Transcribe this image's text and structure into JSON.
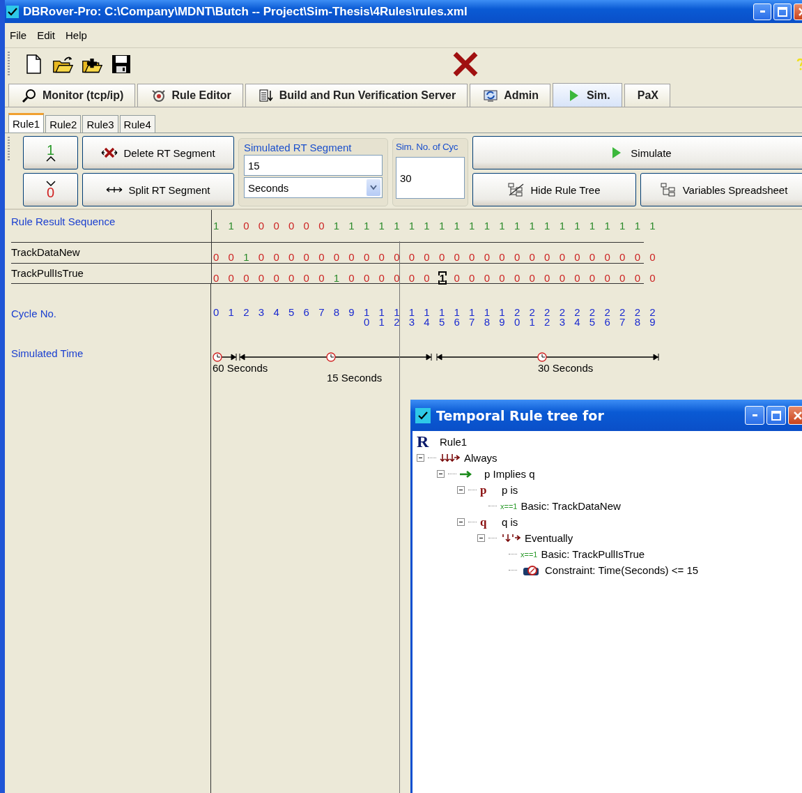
{
  "window": {
    "title": "DBRover-Pro: C:\\Company\\MDNT\\Butch -- Project\\Sim-Thesis\\4Rules\\rules.xml"
  },
  "menu": [
    "File",
    "Edit",
    "Help"
  ],
  "main_tabs": [
    {
      "label": "Monitor (tcp/ip)",
      "kind": "monitor",
      "selected": false
    },
    {
      "label": "Rule Editor",
      "kind": "editor",
      "selected": false
    },
    {
      "label": "Build and Run Verification Server",
      "kind": "build",
      "selected": false
    },
    {
      "label": "Admin",
      "kind": "admin",
      "selected": false
    },
    {
      "label": "Sim.",
      "kind": "sim",
      "selected": true
    },
    {
      "label": "PaX",
      "kind": "none",
      "selected": false
    }
  ],
  "rule_tabs": [
    {
      "label": "Rule1",
      "selected": true
    },
    {
      "label": "Rule2",
      "selected": false
    },
    {
      "label": "Rule3",
      "selected": false
    },
    {
      "label": "Rule4",
      "selected": false
    }
  ],
  "controls": {
    "increment_button": "1",
    "delete_button": "Delete RT Segment",
    "decrement_button": "0",
    "split_button": "Split RT Segment",
    "segment_group": {
      "legend": "Simulated RT Segment",
      "value": "15",
      "unit": "Seconds"
    },
    "cycles_group": {
      "legend": "Sim. No. of Cyc",
      "value": "30"
    },
    "simulate_button": "Simulate",
    "hide_tree_button": "Hide Rule Tree",
    "variables_button": "Variables Spreadsheet"
  },
  "sequence": {
    "rows": [
      {
        "label": "Rule Result Sequence",
        "kind": "result",
        "values": [
          "1",
          "1",
          "0",
          "0",
          "0",
          "0",
          "0",
          "0",
          "1",
          "1",
          "1",
          "1",
          "1",
          "1",
          "1",
          "1",
          "1",
          "1",
          "1",
          "1",
          "1",
          "1",
          "1",
          "1",
          "1",
          "1",
          "1",
          "1",
          "1",
          "1"
        ]
      },
      {
        "label": "TrackDataNew",
        "kind": "variable",
        "values": [
          "0",
          "0",
          "1",
          "0",
          "0",
          "0",
          "0",
          "0",
          "0",
          "0",
          "0",
          "0",
          "0",
          "0",
          "0",
          "0",
          "0",
          "0",
          "0",
          "0",
          "0",
          "0",
          "0",
          "0",
          "0",
          "0",
          "0",
          "0",
          "0",
          "0"
        ]
      },
      {
        "label": "TrackPullIsTrue",
        "kind": "variable",
        "values": [
          "0",
          "0",
          "0",
          "0",
          "0",
          "0",
          "0",
          "0",
          "1",
          "0",
          "0",
          "0",
          "0",
          "0",
          "0",
          "1",
          "0",
          "0",
          "0",
          "0",
          "0",
          "0",
          "0",
          "0",
          "0",
          "0",
          "0",
          "0",
          "0",
          "0"
        ],
        "selected_cells": [
          false,
          false,
          false,
          false,
          false,
          false,
          false,
          false,
          false,
          false,
          false,
          false,
          false,
          false,
          false,
          true,
          false,
          false,
          false,
          false,
          false,
          false,
          false,
          false,
          false,
          false,
          false,
          false,
          false,
          false
        ]
      }
    ],
    "cycle_label": "Cycle No.",
    "cycles": [
      "0",
      "1",
      "2",
      "3",
      "4",
      "5",
      "6",
      "7",
      "8",
      "9",
      "10",
      "11",
      "12",
      "13",
      "14",
      "15",
      "16",
      "17",
      "18",
      "19",
      "20",
      "21",
      "22",
      "23",
      "24",
      "25",
      "26",
      "27",
      "28",
      "29"
    ],
    "time_label": "Simulated Time",
    "segments": [
      {
        "label": "60 Seconds"
      },
      {
        "label": "15 Seconds"
      },
      {
        "label": "30 Seconds"
      }
    ]
  },
  "rule_tree_window": {
    "title": "Temporal Rule tree for",
    "tree": [
      {
        "label": "Rule1",
        "kind": "rule",
        "symbol": "R",
        "children": [
          {
            "label": "Always",
            "kind": "always",
            "expanded": true,
            "children": [
              {
                "label": "p Implies q",
                "kind": "implies",
                "expanded": true,
                "children": [
                  {
                    "label": "p is",
                    "symbol": "p",
                    "expanded": true,
                    "children": [
                      {
                        "label": "Basic: TrackDataNew",
                        "kind": "basic",
                        "symbol": "x==1"
                      }
                    ]
                  },
                  {
                    "label": "q is",
                    "symbol": "q",
                    "expanded": true,
                    "children": [
                      {
                        "label": "Eventually",
                        "kind": "eventually",
                        "expanded": true,
                        "children": [
                          {
                            "label": "Basic: TrackPullIsTrue",
                            "kind": "basic",
                            "symbol": "x==1"
                          },
                          {
                            "label": "Constraint:  Time(Seconds) <= 15",
                            "kind": "constraint"
                          }
                        ]
                      }
                    ]
                  }
                ]
              }
            ]
          }
        ]
      }
    ]
  }
}
